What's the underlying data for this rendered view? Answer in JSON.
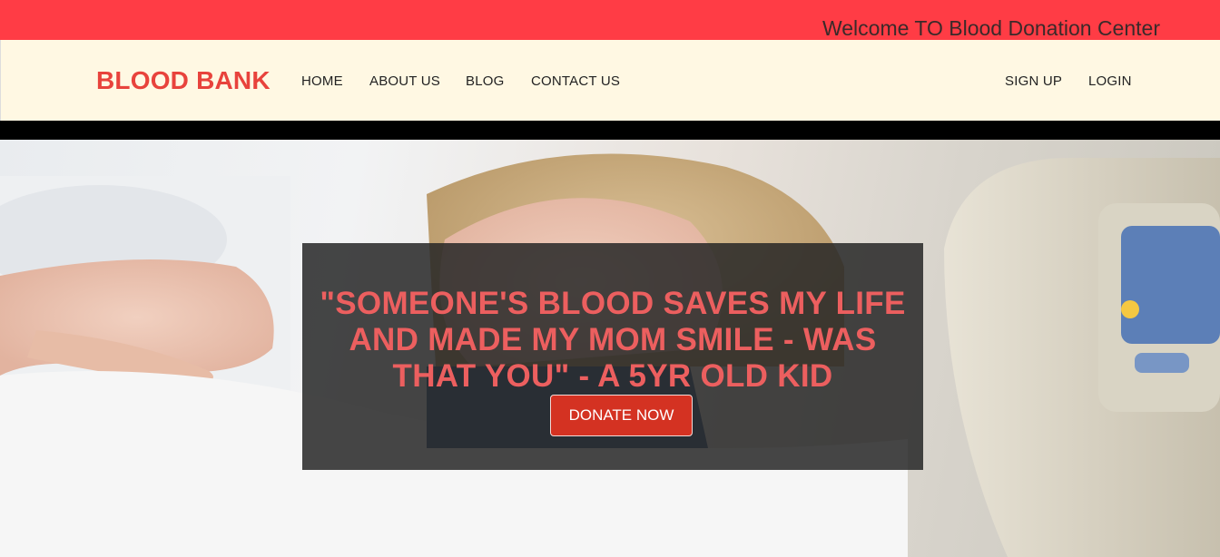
{
  "topbar": {
    "welcome_text": "Welcome TO Blood Donation Center"
  },
  "navbar": {
    "brand": "BLOOD BANK",
    "links": [
      "HOME",
      "ABOUT US",
      "BLOG",
      "CONTACT US"
    ],
    "auth_links": [
      "SIGN UP",
      "LOGIN"
    ]
  },
  "hero": {
    "quote_lines": [
      "\"SOMEONE'S BLOOD SAVES MY LIFE",
      "AND MADE MY MOM SMILE - WAS",
      "THAT YOU\" - A 5YR OLD KID"
    ],
    "donate_label": "DONATE NOW"
  },
  "colors": {
    "topbar": "#ff3c45",
    "navbar": "#fff8e3",
    "brand": "#e8433c",
    "quote": "#ec5f5f",
    "donate_button": "#d43222"
  }
}
